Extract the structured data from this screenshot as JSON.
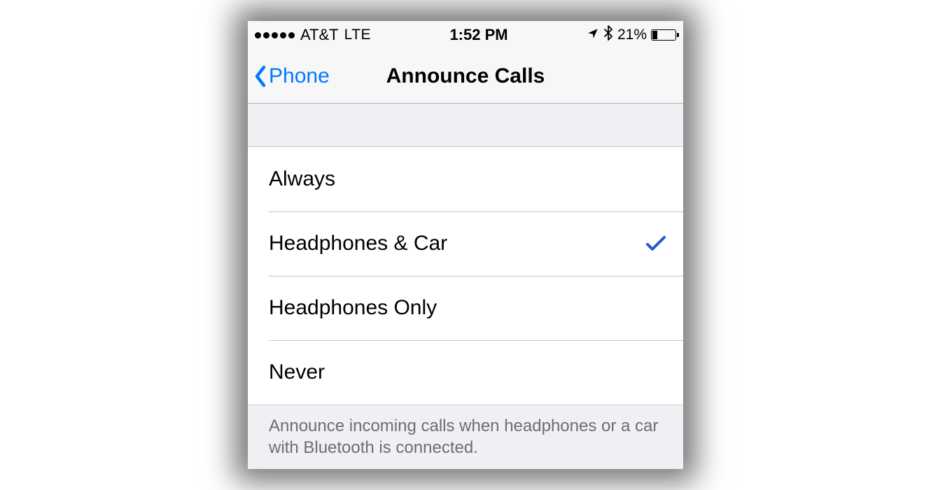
{
  "statusBar": {
    "carrier": "AT&T",
    "network": "LTE",
    "time": "1:52 PM",
    "batteryPercent": "21%"
  },
  "nav": {
    "backLabel": "Phone",
    "title": "Announce Calls"
  },
  "options": [
    {
      "label": "Always",
      "selected": false
    },
    {
      "label": "Headphones & Car",
      "selected": true
    },
    {
      "label": "Headphones Only",
      "selected": false
    },
    {
      "label": "Never",
      "selected": false
    }
  ],
  "footer": "Announce incoming calls when headphones or a car with Bluetooth is connected."
}
